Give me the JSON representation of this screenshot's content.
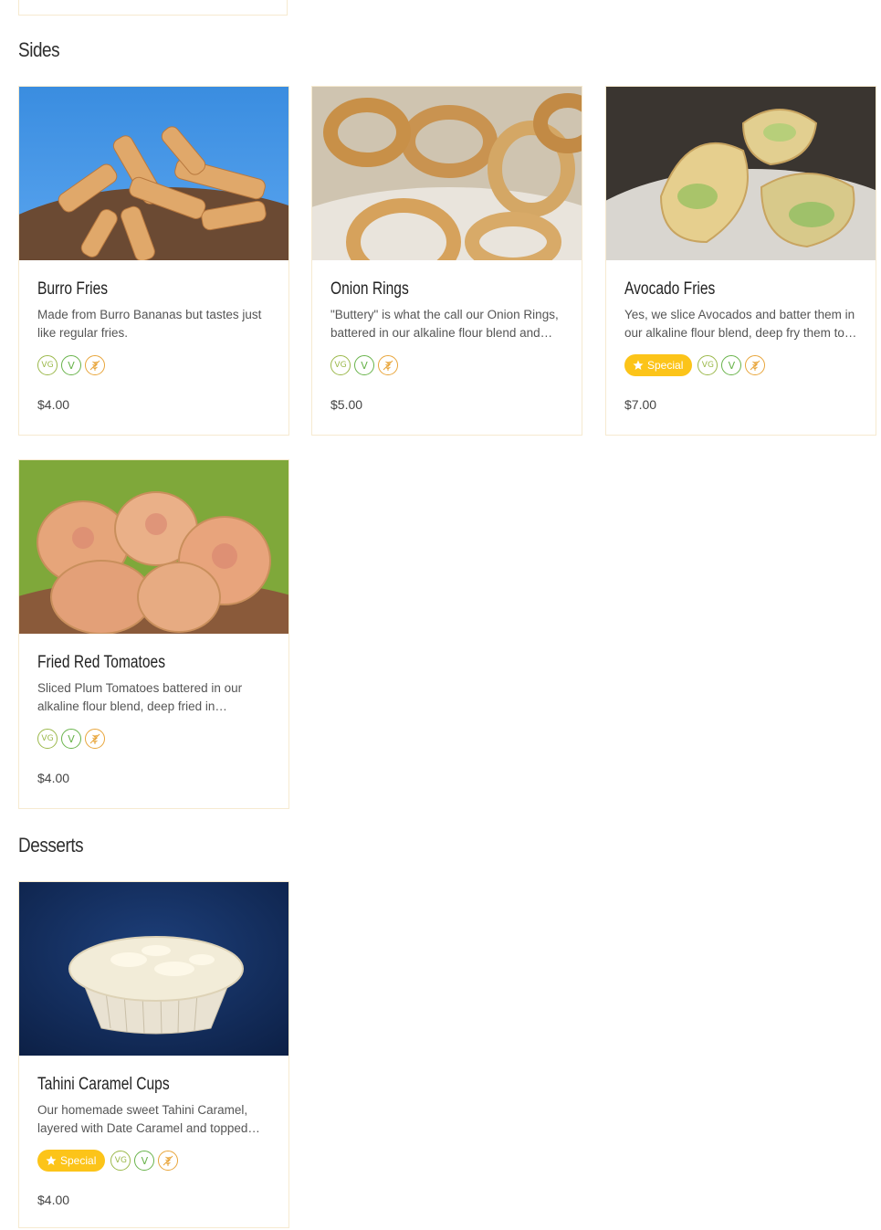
{
  "sections": {
    "sides": {
      "title": "Sides"
    },
    "desserts": {
      "title": "Desserts"
    }
  },
  "items": {
    "burro_fries": {
      "name": "Burro Fries",
      "description": "Made from Burro Bananas but tastes just like regular fries.",
      "price": "$4.00",
      "special": false,
      "tags": [
        "VG",
        "V",
        "wheat-free-icon"
      ]
    },
    "onion_rings": {
      "name": "Onion Rings",
      "description": "\"Buttery\" is what the call our Onion Rings, battered in our alkaline flour blend and deep fried.",
      "price": "$5.00",
      "special": false,
      "tags": [
        "VG",
        "V",
        "wheat-free-icon"
      ]
    },
    "avocado_fries": {
      "name": "Avocado Fries",
      "description": "Yes, we slice Avocados and batter them in our alkaline flour blend, deep fry them to perfection.",
      "price": "$7.00",
      "special": true,
      "special_label": "Special",
      "tags": [
        "VG",
        "V",
        "wheat-free-icon"
      ]
    },
    "fried_red_tomatoes": {
      "name": "Fried Red Tomatoes",
      "description": "Sliced Plum Tomatoes battered in our alkaline flour blend, deep fried in grapeseed oil.",
      "price": "$4.00",
      "special": false,
      "tags": [
        "VG",
        "V",
        "wheat-free-icon"
      ]
    },
    "tahini_caramel_cups": {
      "name": "Tahini Caramel Cups",
      "description": "Our homemade sweet Tahini Caramel, layered with Date Caramel and topped with coconut.",
      "price": "$4.00",
      "special": true,
      "special_label": "Special",
      "tags": [
        "VG",
        "V",
        "wheat-free-icon"
      ]
    }
  },
  "tag_labels": {
    "vg": "VG",
    "v": "V"
  },
  "colors": {
    "accent": "#fcc419",
    "card_border": "#f6ead0",
    "vg": "#9bb84a",
    "v": "#68b34a",
    "gluten_free": "#e8a53a"
  }
}
